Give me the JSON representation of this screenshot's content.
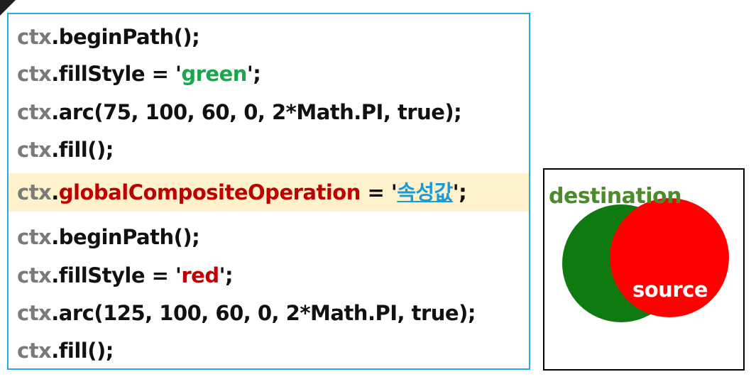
{
  "code": {
    "lines": [
      {
        "obj": "ctx",
        "dot": ".",
        "pre": "beginPath();",
        "str": "",
        "post": ""
      },
      {
        "obj": "ctx",
        "dot": ".",
        "pre": "fillStyle = '",
        "str": "green",
        "post": "';"
      },
      {
        "obj": "ctx",
        "dot": ".",
        "pre": "arc(75, 100, 60, 0, 2*Math.PI, true);",
        "str": "",
        "post": ""
      },
      {
        "obj": "ctx",
        "dot": ".",
        "pre": "fill();",
        "str": "",
        "post": ""
      },
      {
        "obj": "ctx",
        "dot": ".",
        "prop": "globalCompositeOperation",
        "pre": " = '",
        "str": "속성값",
        "post": "';"
      },
      {
        "obj": "ctx",
        "dot": ".",
        "pre": "beginPath();",
        "str": "",
        "post": ""
      },
      {
        "obj": "ctx",
        "dot": ".",
        "pre": "fillStyle = '",
        "str": "red",
        "post": "';"
      },
      {
        "obj": "ctx",
        "dot": ".",
        "pre": "arc(125, 100, 60, 0, 2*Math.PI, true);",
        "str": "",
        "post": ""
      },
      {
        "obj": "ctx",
        "dot": ".",
        "pre": "fill();",
        "str": "",
        "post": ""
      }
    ]
  },
  "demo": {
    "destination_label": "destination",
    "source_label": "source",
    "destination_color": "#0e7a10",
    "source_color": "#ff0000"
  }
}
